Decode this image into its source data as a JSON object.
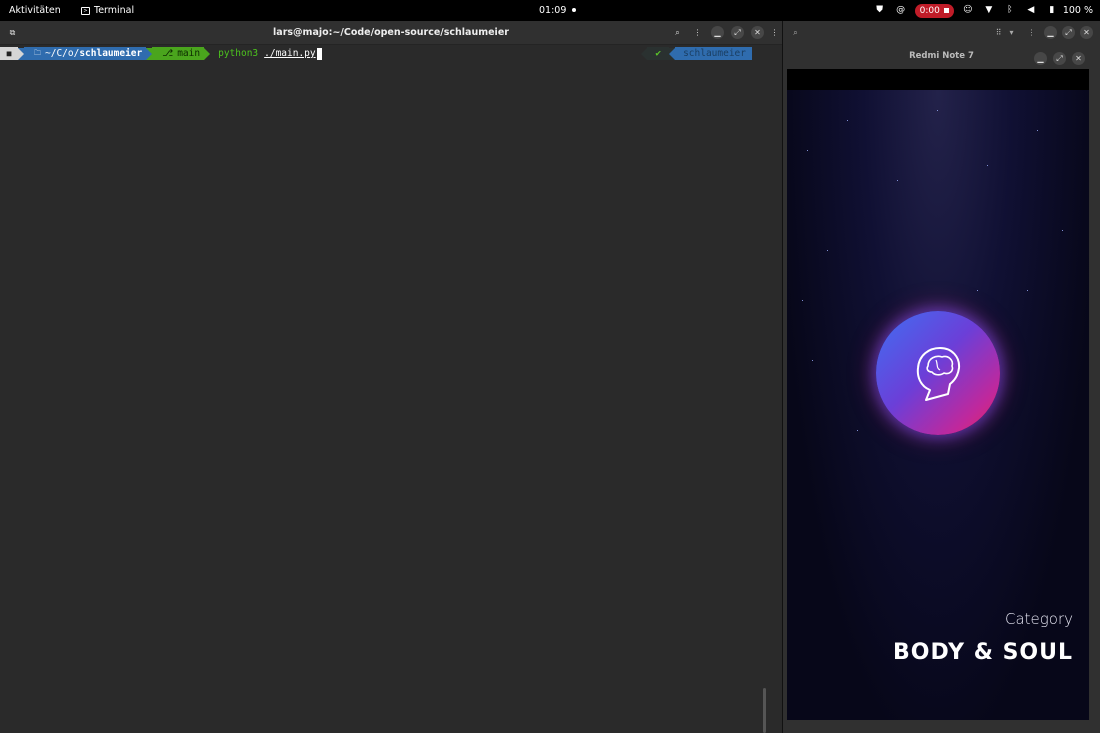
{
  "topbar": {
    "activities": "Aktivitäten",
    "app_name": "Terminal",
    "clock": "01:09",
    "recording_time": "0:00",
    "battery": "100 %"
  },
  "terminal": {
    "title": "lars@majo:~/Code/open-source/schlaumeier",
    "prompt": {
      "dir_prefix": "~/C/o/",
      "dir_name": "schlaumeier",
      "branch_icon": "⎇",
      "branch": "main",
      "command": "python3",
      "argument": "./main.py"
    },
    "right_prompt": {
      "status": "✔",
      "env": "schlaumeier"
    }
  },
  "device_window": {
    "title": "Redmi Note 7",
    "app": {
      "category_label": "Category",
      "category_name": "BODY & SOUL"
    }
  },
  "colors": {
    "accent_blue": "#2f6cae",
    "accent_green": "#4aa51d",
    "record_red": "#c01c28",
    "orb_start": "#3f6ff2",
    "orb_end": "#e8245a"
  }
}
